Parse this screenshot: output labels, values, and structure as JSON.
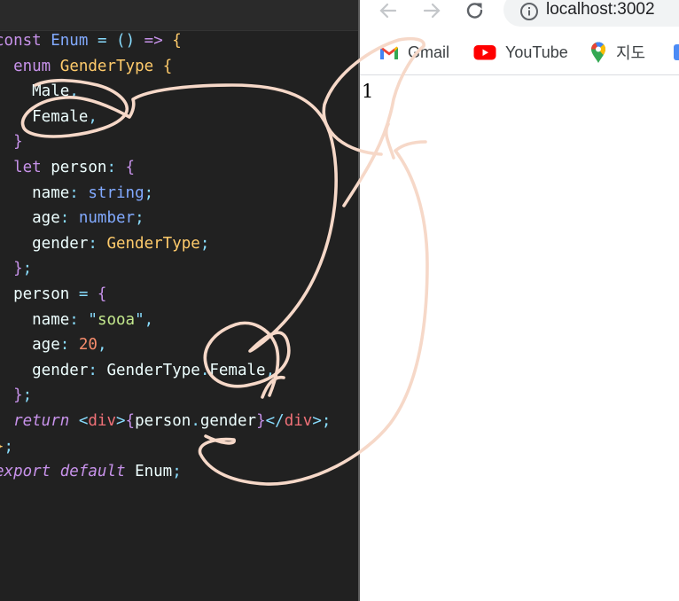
{
  "editor": {
    "lines": [
      [
        {
          "c": "k",
          "t": "const"
        },
        {
          "c": "tx",
          "t": " "
        },
        {
          "c": "fn",
          "t": "Enum"
        },
        {
          "c": "tx",
          "t": " "
        },
        {
          "c": "pn",
          "t": "="
        },
        {
          "c": "tx",
          "t": " "
        },
        {
          "c": "pn",
          "t": "()"
        },
        {
          "c": "tx",
          "t": " "
        },
        {
          "c": "k",
          "t": "=>"
        },
        {
          "c": "tx",
          "t": " "
        },
        {
          "c": "ty",
          "t": "{"
        }
      ],
      [
        {
          "c": "tx",
          "t": "  "
        },
        {
          "c": "k",
          "t": "enum"
        },
        {
          "c": "tx",
          "t": " "
        },
        {
          "c": "ty",
          "t": "GenderType"
        },
        {
          "c": "tx",
          "t": " "
        },
        {
          "c": "ty",
          "t": "{"
        }
      ],
      [
        {
          "c": "tx",
          "t": "    Male"
        },
        {
          "c": "pn",
          "t": ","
        }
      ],
      [
        {
          "c": "tx",
          "t": "    Female"
        },
        {
          "c": "pn",
          "t": ","
        }
      ],
      [
        {
          "c": "tx",
          "t": "  "
        },
        {
          "c": "k",
          "t": "}"
        }
      ],
      [
        {
          "c": "tx",
          "t": "  "
        },
        {
          "c": "k",
          "t": "let"
        },
        {
          "c": "tx",
          "t": " person"
        },
        {
          "c": "pn",
          "t": ":"
        },
        {
          "c": "tx",
          "t": " "
        },
        {
          "c": "k",
          "t": "{"
        }
      ],
      [
        {
          "c": "tx",
          "t": "    name"
        },
        {
          "c": "pn",
          "t": ":"
        },
        {
          "c": "tx",
          "t": " "
        },
        {
          "c": "fn",
          "t": "string"
        },
        {
          "c": "pn",
          "t": ";"
        }
      ],
      [
        {
          "c": "tx",
          "t": "    age"
        },
        {
          "c": "pn",
          "t": ":"
        },
        {
          "c": "tx",
          "t": " "
        },
        {
          "c": "fn",
          "t": "number"
        },
        {
          "c": "pn",
          "t": ";"
        }
      ],
      [
        {
          "c": "tx",
          "t": "    gender"
        },
        {
          "c": "pn",
          "t": ":"
        },
        {
          "c": "tx",
          "t": " "
        },
        {
          "c": "ty",
          "t": "GenderType"
        },
        {
          "c": "pn",
          "t": ";"
        }
      ],
      [
        {
          "c": "tx",
          "t": "  "
        },
        {
          "c": "k",
          "t": "}"
        },
        {
          "c": "pn",
          "t": ";"
        }
      ],
      [
        {
          "c": "tx",
          "t": "  person "
        },
        {
          "c": "pn",
          "t": "="
        },
        {
          "c": "tx",
          "t": " "
        },
        {
          "c": "k",
          "t": "{"
        }
      ],
      [
        {
          "c": "tx",
          "t": "    name"
        },
        {
          "c": "pn",
          "t": ":"
        },
        {
          "c": "tx",
          "t": " "
        },
        {
          "c": "pn",
          "t": "\""
        },
        {
          "c": "st",
          "t": "sooa"
        },
        {
          "c": "pn",
          "t": "\","
        }
      ],
      [
        {
          "c": "tx",
          "t": "    age"
        },
        {
          "c": "pn",
          "t": ":"
        },
        {
          "c": "tx",
          "t": " "
        },
        {
          "c": "nu",
          "t": "20"
        },
        {
          "c": "pn",
          "t": ","
        }
      ],
      [
        {
          "c": "tx",
          "t": "    gender"
        },
        {
          "c": "pn",
          "t": ":"
        },
        {
          "c": "tx",
          "t": " GenderType"
        },
        {
          "c": "pn",
          "t": "."
        },
        {
          "c": "tx",
          "t": "Female"
        },
        {
          "c": "pn",
          "t": ","
        }
      ],
      [
        {
          "c": "tx",
          "t": "  "
        },
        {
          "c": "k",
          "t": "}"
        },
        {
          "c": "pn",
          "t": ";"
        }
      ],
      [
        {
          "c": "tx",
          "t": "  "
        },
        {
          "c": "kk",
          "t": "return"
        },
        {
          "c": "tx",
          "t": " "
        },
        {
          "c": "pn",
          "t": "<"
        },
        {
          "c": "tg",
          "t": "div"
        },
        {
          "c": "pn",
          "t": ">"
        },
        {
          "c": "k",
          "t": "{"
        },
        {
          "c": "tx",
          "t": "person"
        },
        {
          "c": "pn",
          "t": "."
        },
        {
          "c": "tx",
          "t": "gender"
        },
        {
          "c": "k",
          "t": "}"
        },
        {
          "c": "pn",
          "t": "</"
        },
        {
          "c": "tg",
          "t": "div"
        },
        {
          "c": "pn",
          "t": ">;"
        }
      ],
      [
        {
          "c": "ty",
          "t": "}"
        },
        {
          "c": "pn",
          "t": ";"
        }
      ],
      [
        {
          "c": "kk",
          "t": "export"
        },
        {
          "c": "tx",
          "t": " "
        },
        {
          "c": "kk",
          "t": "default"
        },
        {
          "c": "tx",
          "t": " Enum"
        },
        {
          "c": "pn",
          "t": ";"
        }
      ]
    ]
  },
  "browser": {
    "url": "localhost:3002",
    "bookmarks": [
      {
        "label": "Gmail",
        "icon": "gmail-icon"
      },
      {
        "label": "YouTube",
        "icon": "youtube-icon"
      },
      {
        "label": "지도",
        "icon": "maps-icon"
      }
    ],
    "page_text": "1"
  },
  "colors": {
    "editor_bg": "#212121",
    "keyword": "#c792ea",
    "function": "#82aaff",
    "type": "#ffcb6b",
    "punctuation": "#89ddff",
    "string": "#c3e88d",
    "number": "#f78c6c",
    "tag": "#f07178",
    "text": "#eeffff",
    "doodle": "#f5d5c5"
  }
}
